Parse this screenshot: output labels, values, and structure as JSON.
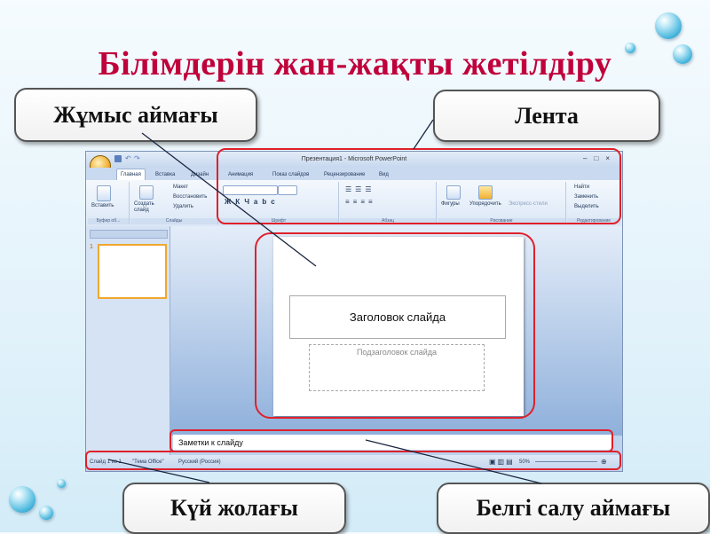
{
  "title": "Білімдерін  жан-жақты жетілдіру",
  "callouts": {
    "work_area": "Жұмыс аймағы",
    "ribbon": "Лента",
    "status_bar": "Күй жолағы",
    "notes_area": "Белгі салу аймағы"
  },
  "window": {
    "title": "Презентация1 - Microsoft PowerPoint",
    "tabs": [
      "Главная",
      "Вставка",
      "Дизайн",
      "Анимация",
      "Показ слайдов",
      "Рецензирование",
      "Вид"
    ],
    "ribbon": {
      "paste_label": "Вставить",
      "create_slide_label": "Создать слайд",
      "layout_label": "Макет",
      "reset_label": "Восстановить",
      "delete_label": "Удалить",
      "shapes_label": "Фигуры",
      "arrange_label": "Упорядочить",
      "quick_styles_label": "Экспресс-стили",
      "find_label": "Найти",
      "replace_label": "Заменить",
      "select_label": "Выделить",
      "group_clipboard": "Буфер об...",
      "group_slides": "Слайды",
      "group_font": "Шрифт",
      "group_paragraph": "Абзац",
      "group_drawing": "Рисование",
      "group_editing": "Редактирование"
    },
    "slide": {
      "title_placeholder": "Заголовок слайда",
      "subtitle_placeholder": "Подзаголовок слайда"
    },
    "notes_placeholder": "Заметки к слайду",
    "status": {
      "slide_count": "Слайд 1 из 1",
      "theme": "\"Тема Office\"",
      "language": "Русский (Россия)",
      "zoom": "50%"
    },
    "thumbnail_number": "1"
  },
  "colors": {
    "title": "#c0003a",
    "highlight": "#e0202a"
  }
}
